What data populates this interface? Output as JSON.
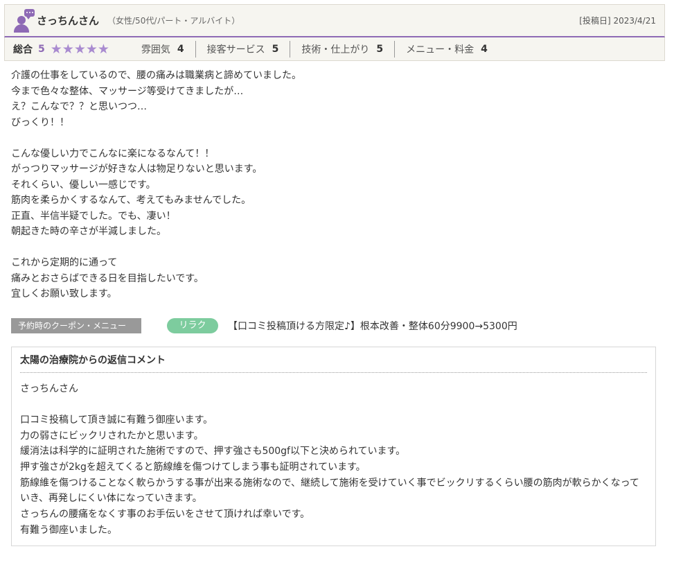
{
  "header": {
    "name": "さっちんさん",
    "meta": "（女性/50代/パート・アルバイト）",
    "post_date": "[投稿日] 2023/4/21"
  },
  "ratings": {
    "overall_label": "総合",
    "overall_score": "5",
    "stars": "★★★★★",
    "items": [
      {
        "label": "雰囲気",
        "value": "4"
      },
      {
        "label": "接客サービス",
        "value": "5"
      },
      {
        "label": "技術・仕上がり",
        "value": "5"
      },
      {
        "label": "メニュー・料金",
        "value": "4"
      }
    ]
  },
  "review_text": "介護の仕事をしているので、腰の痛みは職業病と諦めていました。\n今まで色々な整体、マッサージ等受けてきましたが…\nえ？こんなで？？と思いつつ…\nびっくり！！\n\nこんな優しい力でこんなに楽になるなんて！！\nがっつりマッサージが好きな人は物足りないと思います。\nそれくらい、優しい一感じです。\n筋肉を柔らかくするなんて、考えてもみませんでした。\n正直、半信半疑でした。でも、凄い！\n朝起きた時の辛さが半減しました。\n\nこれから定期的に通って\n痛みとおさらばできる日を目指したいです。\n宜しくお願い致します。",
  "coupon": {
    "label": "予約時のクーポン・メニュー",
    "tag": "リラク",
    "text": "【口コミ投稿頂ける方限定♪】根本改善・整体60分9900→5300円"
  },
  "reply": {
    "title": "太陽の治療院からの返信コメント",
    "text": "さっちんさん\n\n口コミ投稿して頂き誠に有難う御座います。\n力の弱さにビックリされたかと思います。\n緩消法は科学的に証明された施術ですので、押す強さも500gf以下と決められています。\n押す強さが2kgを超えてくると筋線維を傷つけてしまう事も証明されています。\n筋線維を傷つけることなく軟らかうする事が出来る施術なので、継続して施術を受けていく事でビックリするくらい腰の筋肉が軟らかくなっていき、再発しにくい体になっていきます。\nさっちんの腰痛をなくす事のお手伝いをさせて頂ければ幸いです。\n有難う御座いました。"
  },
  "colors": {
    "accent": "#8e6ab5",
    "tag": "#7dcc9e",
    "coupon_label_bg": "#999999"
  }
}
